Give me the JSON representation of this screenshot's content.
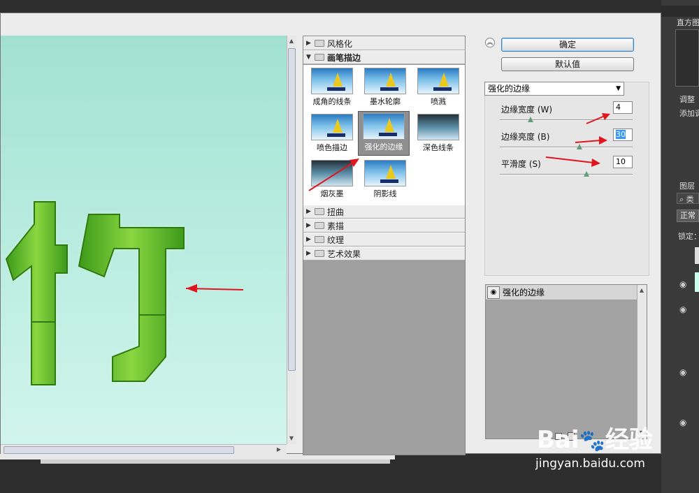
{
  "gallery": {
    "categories_top": [
      {
        "label": "风格化",
        "open": false
      },
      {
        "label": "画笔描边",
        "open": true
      }
    ],
    "thumbnails": [
      {
        "label": "成角的线条"
      },
      {
        "label": "墨水轮廓"
      },
      {
        "label": "喷溅"
      },
      {
        "label": "喷色描边"
      },
      {
        "label": "强化的边缘",
        "selected": true
      },
      {
        "label": "深色线条"
      },
      {
        "label": "烟灰墨"
      },
      {
        "label": "阴影线"
      }
    ],
    "categories_bottom": [
      {
        "label": "扭曲"
      },
      {
        "label": "素描"
      },
      {
        "label": "纹理"
      },
      {
        "label": "艺术效果"
      }
    ]
  },
  "buttons": {
    "ok": "确定",
    "default": "默认值"
  },
  "filter": {
    "selected": "强化的边缘",
    "params": [
      {
        "label": "边缘宽度 (W)",
        "value": "4",
        "level": 0.23
      },
      {
        "label": "边缘亮度 (B)",
        "value": "30",
        "level": 0.6
      },
      {
        "label": "平滑度 (S)",
        "value": "10",
        "level": 0.65
      }
    ]
  },
  "effect_layer": {
    "name": "强化的边缘"
  },
  "ps_panels": {
    "histogram": "直方图",
    "adjustments": "调整",
    "add_adjust": "添加调",
    "layers": "图层",
    "kind_search": "类",
    "blend_mode": "正常",
    "lock": "锁定："
  },
  "preview": {
    "glyph": "竹"
  },
  "watermark": {
    "logo": "Baidu 经验",
    "url": "jingyan.baidu.com"
  },
  "colors": {
    "annotation": "#e0161e",
    "selection": "#3399ff"
  }
}
